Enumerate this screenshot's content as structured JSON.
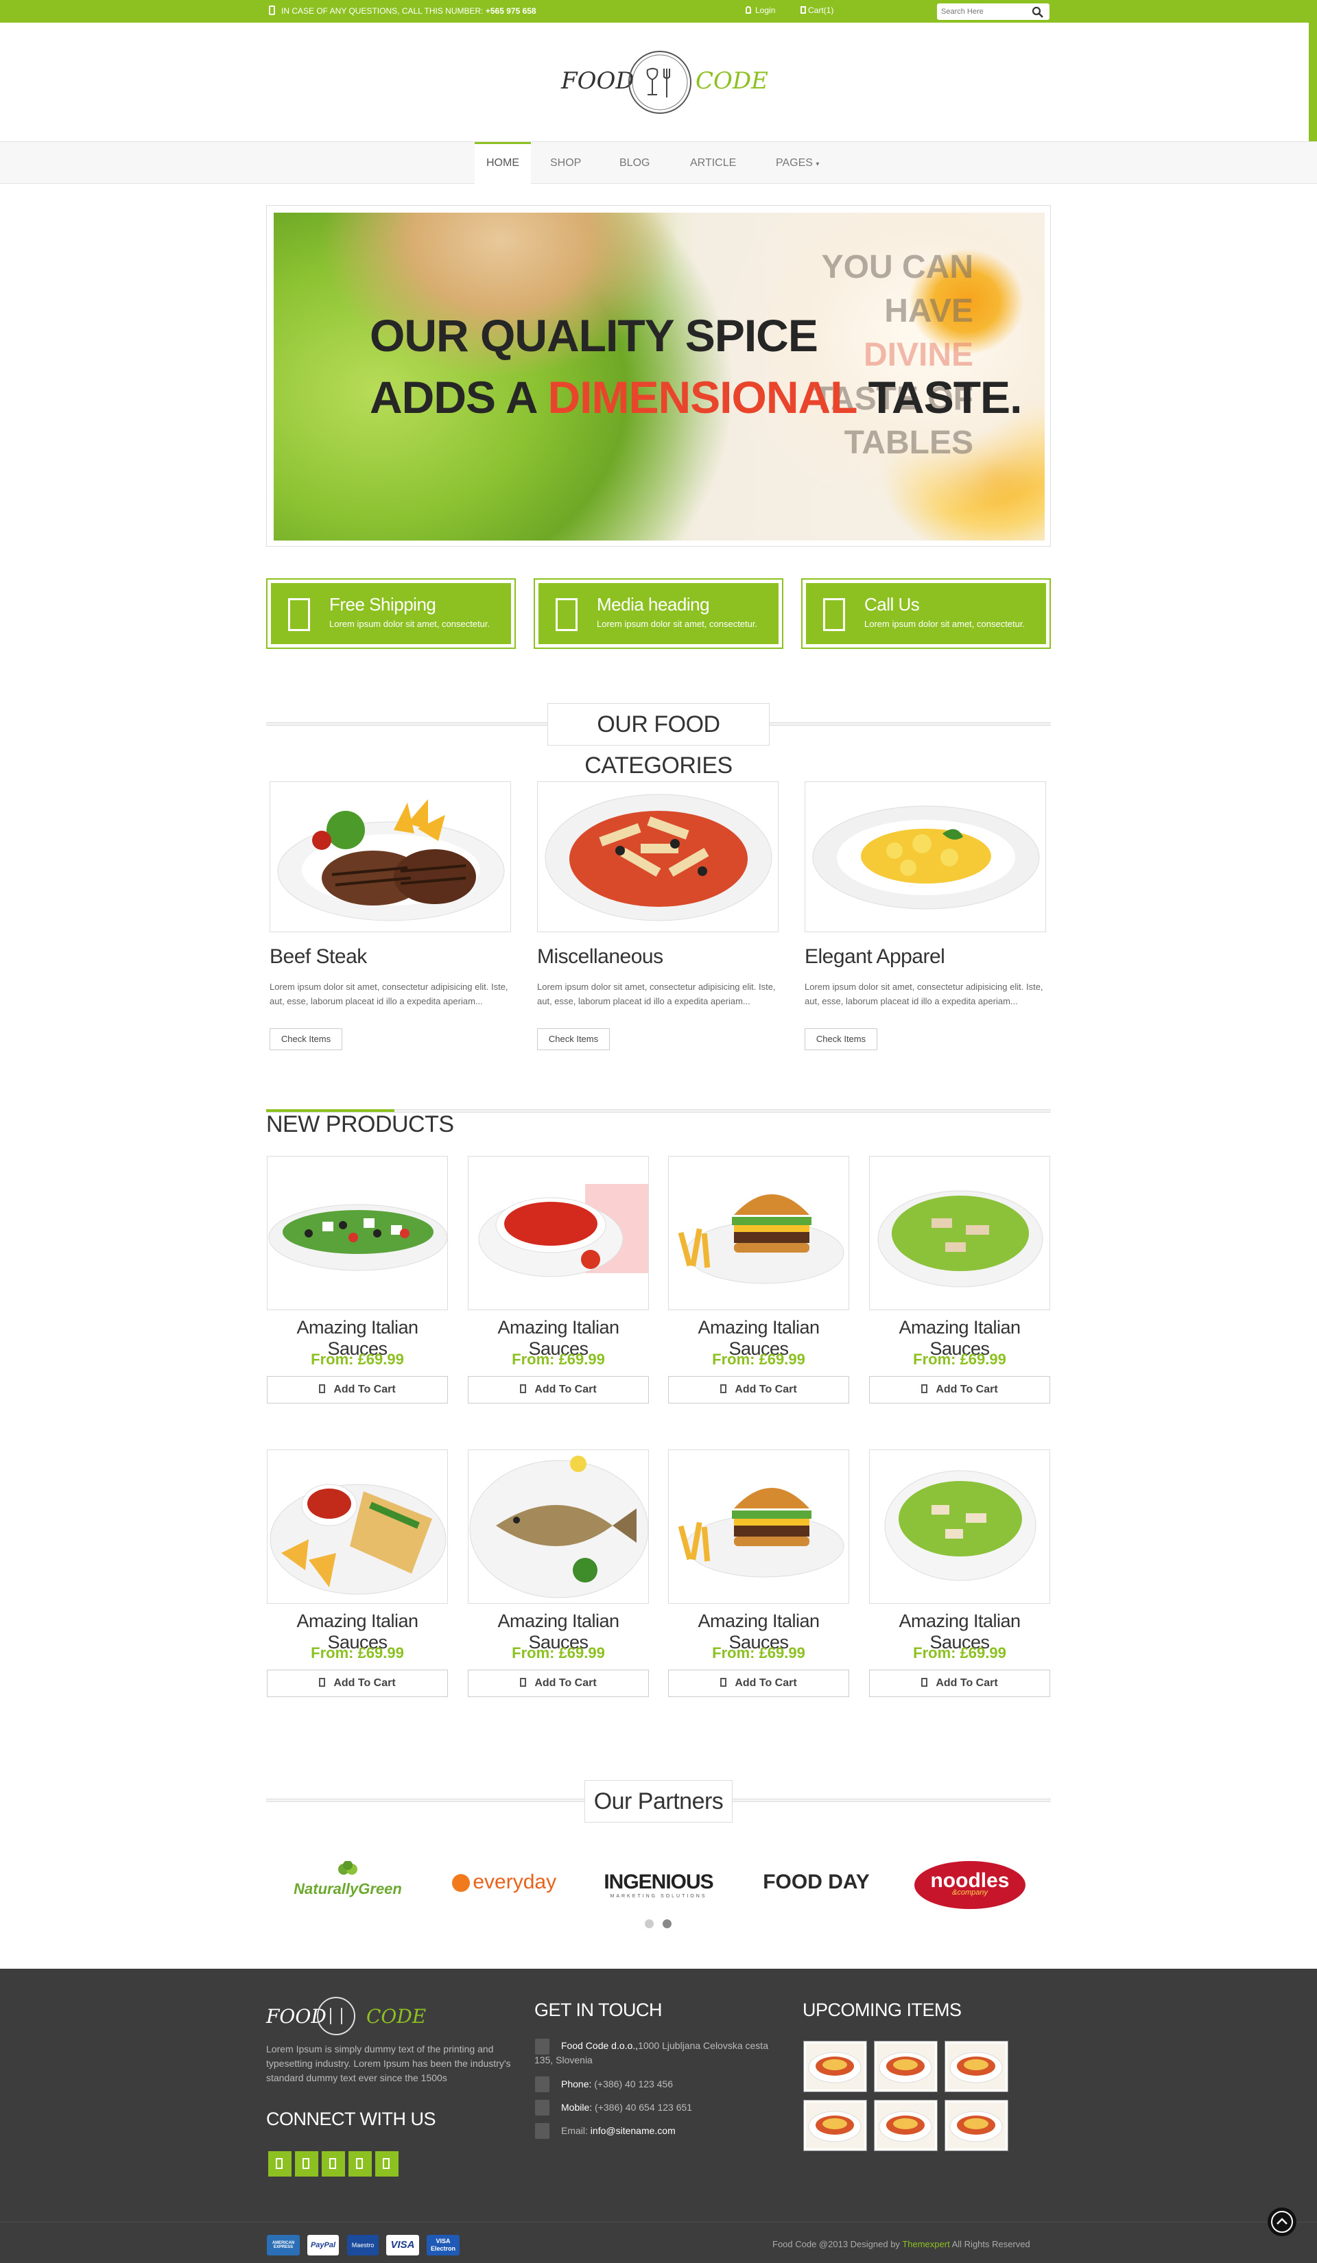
{
  "topbar": {
    "phone_prefix": "IN CASE OF ANY QUESTIONS, CALL THIS NUMBER:",
    "phone_number": "+565 975 658",
    "login": "Login",
    "cart": "Cart(1)",
    "search_placeholder": "Search Here"
  },
  "logo": {
    "left": "FOOD",
    "right": "CODE"
  },
  "nav": {
    "items": [
      "HOME",
      "SHOP",
      "BLOG",
      "ARTICLE",
      "PAGES"
    ]
  },
  "hero": {
    "line1": "OUR QUALITY SPICE",
    "line2_a": "ADDS A",
    "line2_highlight": "DIMENSIONAL",
    "line2_b": "TASTE.",
    "ghost_lines": [
      "YOU CAN HAVE",
      "DIVINE",
      "TASTE OF",
      "TABLES"
    ]
  },
  "features": [
    {
      "title": "Free Shipping",
      "desc": "Lorem ipsum dolor sit amet, consectetur."
    },
    {
      "title": "Media heading",
      "desc": "Lorem ipsum dolor sit amet, consectetur."
    },
    {
      "title": "Call Us",
      "desc": "Lorem ipsum dolor sit amet, consectetur."
    }
  ],
  "categories": {
    "title": "OUR FOOD CATEGORIES",
    "items": [
      {
        "name": "Beef Steak",
        "desc": "Lorem ipsum dolor sit amet, consectetur adipisicing elit. Iste, aut, esse, laborum placeat id illo a expedita aperiam...",
        "button": "Check Items"
      },
      {
        "name": "Miscellaneous",
        "desc": "Lorem ipsum dolor sit amet, consectetur adipisicing elit. Iste, aut, esse, laborum placeat id illo a expedita aperiam...",
        "button": "Check Items"
      },
      {
        "name": "Elegant Apparel",
        "desc": "Lorem ipsum dolor sit amet, consectetur adipisicing elit. Iste, aut, esse, laborum placeat id illo a expedita aperiam...",
        "button": "Check Items"
      }
    ]
  },
  "products": {
    "title": "NEW PRODUCTS",
    "items": [
      {
        "name": "Amazing Italian Sauces",
        "price": "From: £69.99",
        "button": "Add To Cart"
      },
      {
        "name": "Amazing Italian Sauces",
        "price": "From: £69.99",
        "button": "Add To Cart"
      },
      {
        "name": "Amazing Italian Sauces",
        "price": "From: £69.99",
        "button": "Add To Cart"
      },
      {
        "name": "Amazing Italian Sauces",
        "price": "From: £69.99",
        "button": "Add To Cart"
      },
      {
        "name": "Amazing Italian Sauces",
        "price": "From: £69.99",
        "button": "Add To Cart"
      },
      {
        "name": "Amazing Italian Sauces",
        "price": "From: £69.99",
        "button": "Add To Cart"
      },
      {
        "name": "Amazing Italian Sauces",
        "price": "From: £69.99",
        "button": "Add To Cart"
      },
      {
        "name": "Amazing Italian Sauces",
        "price": "From: £69.99",
        "button": "Add To Cart"
      }
    ]
  },
  "partners": {
    "title": "Our Partners",
    "logos": [
      "NaturallyGreen",
      "everyday",
      "INGENIOUS",
      "FOOD DAY",
      "noodles"
    ],
    "logo_sub": {
      "ingenious": "MARKETING SOLUTIONS",
      "noodles": "&company"
    }
  },
  "footer": {
    "about": "Lorem Ipsum is simply dummy text of the printing and typesetting industry. Lorem Ipsum has been the industry's standard dummy text ever since the 1500s",
    "connect_title": "CONNECT WITH US",
    "contact_title": "GET IN TOUCH",
    "company": "Food Code d.o.o.,",
    "address": "1000 Ljubljana Celovska cesta 135, Slovenia",
    "phone_label": "Phone:",
    "phone": "(+386) 40 123 456",
    "mobile_label": "Mobile:",
    "mobile": "(+386) 40 654 123 651",
    "email_label": "Email:",
    "email": "info@sitename.com",
    "upcoming_title": "UPCOMING ITEMS",
    "copyright_a": "Food Code @2013 Designed by",
    "copyright_link": "Themexpert",
    "copyright_b": "All Rights Reserved",
    "payments": [
      "AMERICAN EXPRESS",
      "PayPal",
      "Maestro",
      "VISA",
      "VISA Electron"
    ]
  },
  "colors": {
    "accent": "#8cc121",
    "hero_highlight": "#e8452c",
    "footer_bg": "#3d3d3d"
  },
  "icons": [
    "phone-icon",
    "user-icon",
    "cart-icon",
    "search-icon",
    "truck-icon",
    "media-icon",
    "call-icon",
    "cart-icon",
    "facebook-icon",
    "twitter-icon",
    "google-plus-icon",
    "linkedin-icon",
    "rss-icon",
    "map-marker-icon",
    "mobile-icon",
    "envelope-icon",
    "arrow-up-icon"
  ]
}
